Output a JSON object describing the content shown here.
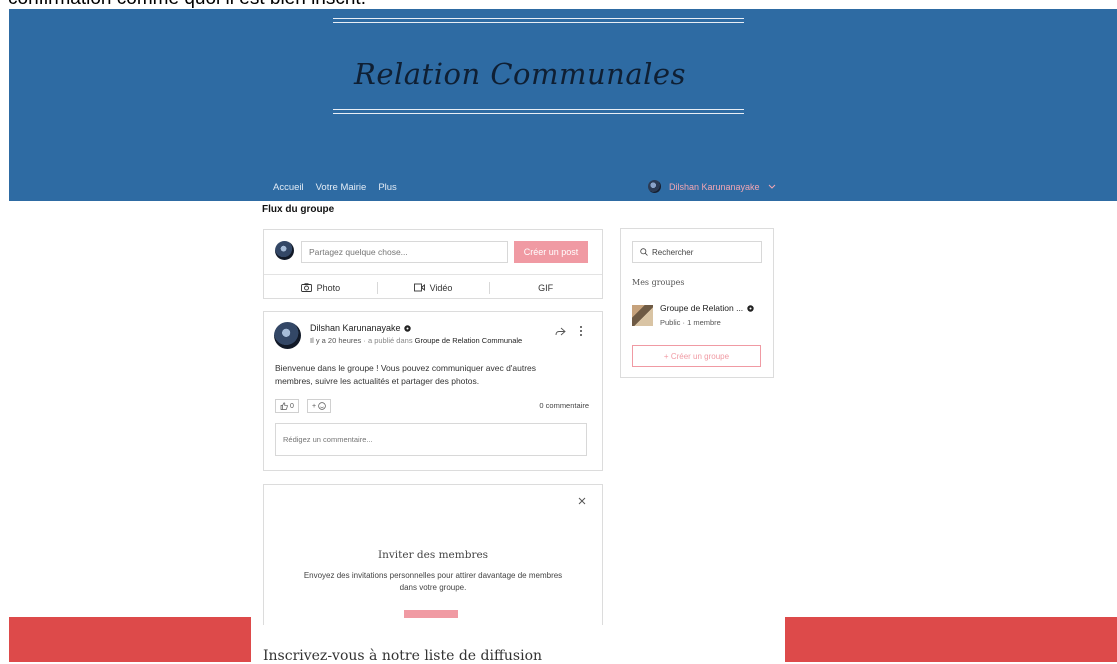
{
  "caption": "confirmation comme quoi il est bien inscrit.",
  "header": {
    "site_title": "Relation Communales",
    "nav": [
      "Accueil",
      "Votre Mairie",
      "Plus"
    ],
    "user_name": "Dilshan Karunanayake",
    "user_menu_icon": "chevron-down-icon"
  },
  "feed": {
    "title": "Flux du groupe",
    "composer": {
      "placeholder": "Partagez quelque chose...",
      "create_post": "Créer un post",
      "photo": "Photo",
      "video": "Vidéo",
      "gif": "GIF"
    },
    "post": {
      "author": "Dilshan Karunanayake",
      "time": "Il y a 20 heures",
      "published_in_prefix": "· a publié dans",
      "group": "Groupe de Relation Communale",
      "body": "Bienvenue dans le groupe ! Vous pouvez communiquer avec d'autres membres, suivre les actualités et partager des photos.",
      "like_count": "0",
      "reaction_add": "+",
      "comment_count": "0 commentaire",
      "comment_placeholder": "Rédigez un commentaire..."
    },
    "invite": {
      "title": "Inviter des membres",
      "description": "Envoyez des invitations personnelles pour attirer davantage de membres dans votre groupe."
    }
  },
  "sidebar": {
    "search_placeholder": "Rechercher",
    "my_groups_label": "Mes groupes",
    "groups": [
      {
        "name": "Groupe de Relation ...",
        "meta": "Public · 1 membre"
      }
    ],
    "create_group": "+ Créer un groupe"
  },
  "footer": {
    "newsletter_title": "Inscrivez-vous à notre liste de diffusion"
  },
  "colors": {
    "header_bg": "#2e6ba3",
    "accent_pink": "#f09aa3",
    "footer_red": "#dd4a4a"
  }
}
